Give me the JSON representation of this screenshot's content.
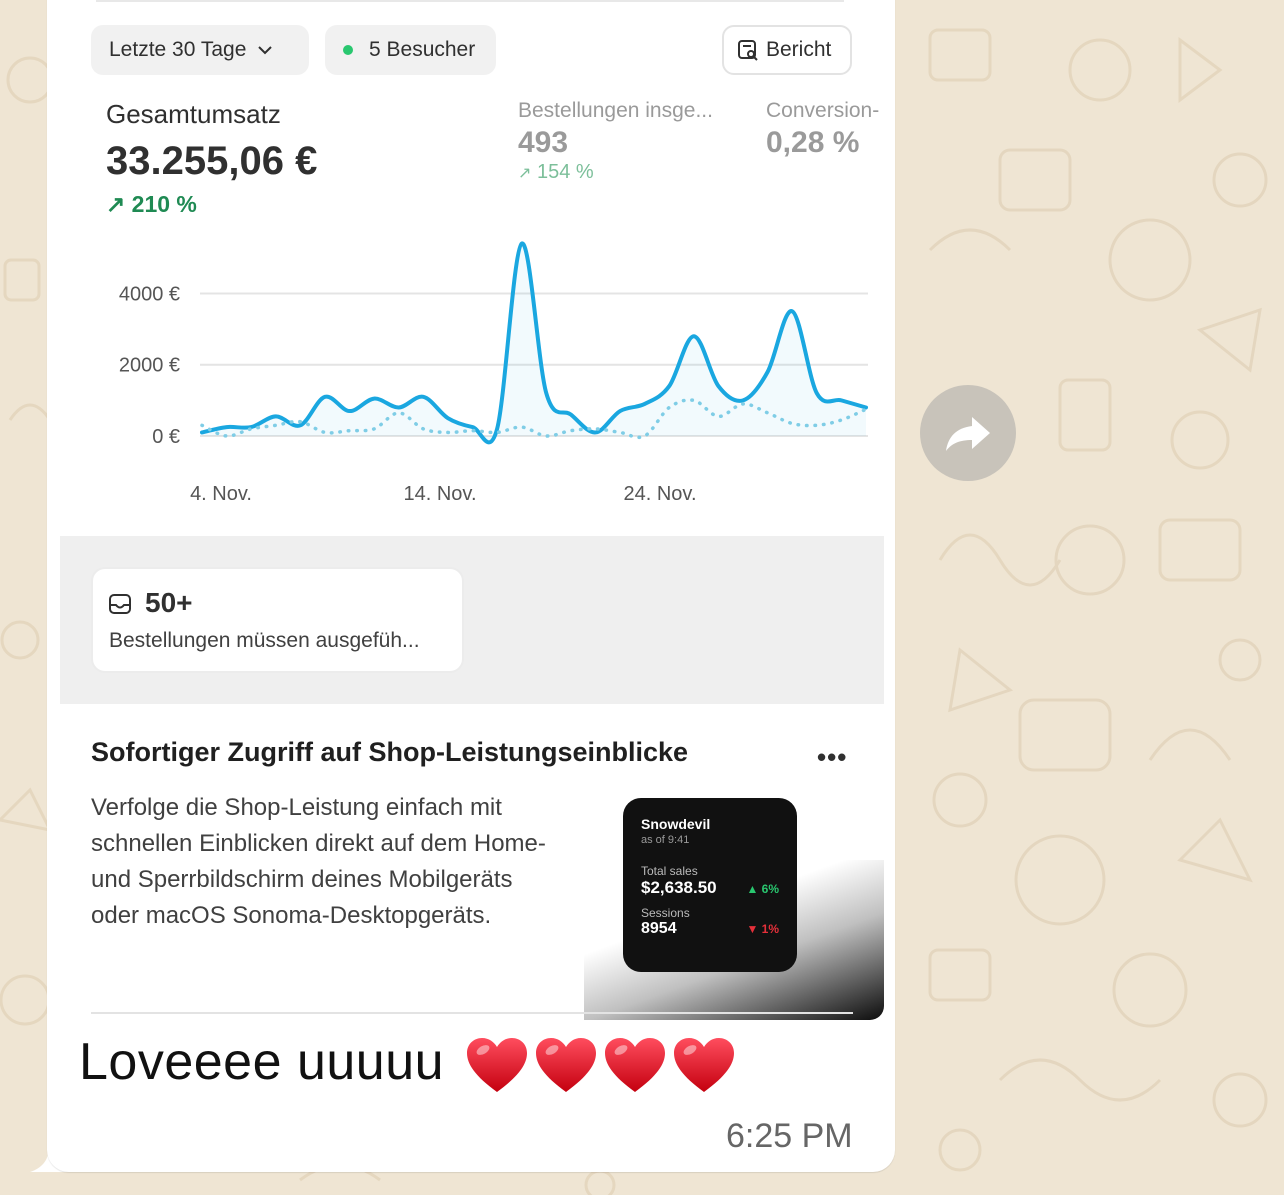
{
  "chat": {
    "message_text": "Loveeee uuuuu",
    "emoji": "❤️❤️❤️❤️",
    "time": "6:25 PM",
    "forward_icon": "share-arrow-icon"
  },
  "dashboard": {
    "range_label": "Letzte 30 Tage",
    "visitors_label": "5 Besucher",
    "report_label": "Bericht",
    "total_sales_label": "Gesamtumsatz",
    "total_sales_value": "33.255,06 €",
    "total_sales_change": "210 %",
    "orders_label": "Bestellungen insge...",
    "orders_value": "493",
    "orders_change": "154 %",
    "conversion_label": "Conversion-",
    "conversion_value": "0,28 %",
    "colors": {
      "accent": "#1aa7e0",
      "positive": "#1f8a53"
    }
  },
  "chart_data": {
    "type": "line",
    "x_tick_labels": [
      "4. Nov.",
      "14. Nov.",
      "24. Nov."
    ],
    "y_tick_labels": [
      "0 €",
      "2000 €",
      "4000 €"
    ],
    "ylim": [
      0,
      5500
    ],
    "grid": true,
    "series": [
      {
        "style": "solid",
        "values": [
          100,
          250,
          250,
          550,
          300,
          1100,
          700,
          1050,
          800,
          1100,
          500,
          250,
          200,
          5400,
          1200,
          600,
          100,
          700,
          900,
          1400,
          2800,
          1400,
          1000,
          1800,
          3500,
          1200,
          1000,
          800
        ]
      },
      {
        "style": "dotted",
        "values": [
          300,
          0,
          200,
          300,
          400,
          100,
          150,
          200,
          650,
          200,
          100,
          150,
          100,
          250,
          0,
          150,
          200,
          100,
          0,
          800,
          1000,
          550,
          900,
          650,
          350,
          300,
          450,
          750
        ]
      }
    ]
  },
  "orders_card": {
    "icon": "inbox-icon",
    "count": "50+",
    "caption": "Bestellungen müssen ausgefüh..."
  },
  "insight": {
    "title": "Sofortiger Zugriff auf Shop-Leistungseinblicke",
    "body": "Verfolge die Shop-Leistung einfach mit schnellen Einblicken direkt auf dem Home- und Sperrbildschirm deines Mobilgeräts oder macOS Sonoma-Desktopgeräts.",
    "widget": {
      "store": "Snowdevil",
      "as_of": "as of 9:41",
      "sales_label": "Total sales",
      "sales_value": "$2,638.50",
      "sales_change": "6%",
      "sessions_label": "Sessions",
      "sessions_value": "8954",
      "sessions_change": "1%"
    }
  }
}
